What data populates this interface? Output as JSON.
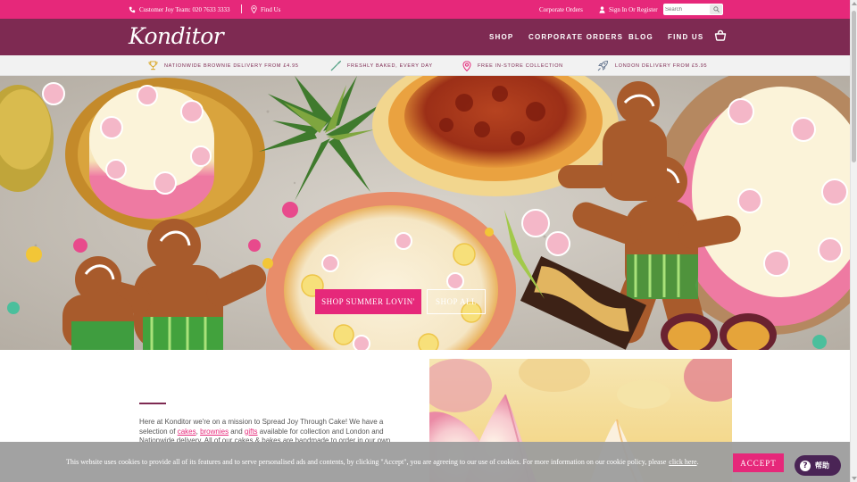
{
  "topbar": {
    "phone_label": "Customer Joy Team: 020 7633 3333",
    "find_us_label": "Find Us",
    "corporate_label": "Corporate Orders",
    "signin_label": "Sign In Or Register",
    "search_placeholder": "Search"
  },
  "nav": {
    "logo_text": "Konditor",
    "items": [
      {
        "label": "SHOP"
      },
      {
        "label": "CORPORATE ORDERS"
      },
      {
        "label": "BLOG"
      },
      {
        "label": "FIND US"
      }
    ],
    "basket_icon": "basket-icon"
  },
  "usp": [
    {
      "label": "NATIONWIDE BROWNIE DELIVERY FROM £4.95",
      "icon": "trophy-icon"
    },
    {
      "label": "FRESHLY BAKED, EVERY DAY",
      "icon": "whisk-icon"
    },
    {
      "label": "FREE IN-STORE COLLECTION",
      "icon": "map-pin-icon"
    },
    {
      "label": "LONDON DELIVERY FROM £5.95",
      "icon": "rocket-icon"
    }
  ],
  "hero": {
    "primary_button": "SHOP SUMMER LOVIN'",
    "secondary_button": "SHOP ALL",
    "chevron_icon": "chevron-down-icon"
  },
  "intro": {
    "text_start": "Here at Konditor we're on a mission to Spread Joy Through Cake! We have a selection of ",
    "link_cakes": "cakes",
    "sep1": ", ",
    "link_brownies": "brownies",
    "sep2": " and ",
    "link_gifts": "gifts",
    "text_end": " available for collection and London and Nationwide delivery. All of our cakes & bakes are handmade to order in our own"
  },
  "cookie": {
    "message": "This website uses cookies to provide all of its features and to serve personalised ads and contents, by clicking \"Accept\", you are agreeing to our use of cookies. For more information on our cookie policy, please",
    "link": "click here",
    "link_suffix": ".",
    "accept_label": "ACCEPT"
  },
  "help": {
    "label": "帮助"
  },
  "colors": {
    "brand_pink": "#e6287a",
    "brand_plum": "#7e2a52",
    "usp_background": "#f2f2f2",
    "help_purple": "#4a2455"
  }
}
